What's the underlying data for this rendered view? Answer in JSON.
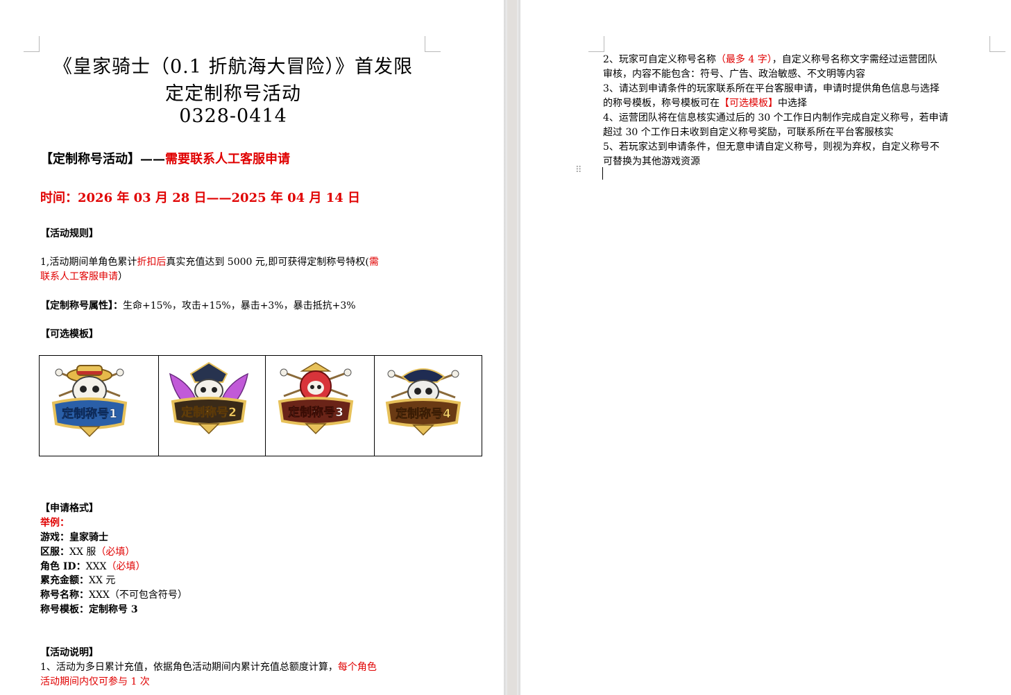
{
  "page1": {
    "title_lines": [
      "《皇家骑士（0.1 折航海大冒险）》首发限",
      "定定制称号活动",
      "0328-0414"
    ],
    "activity_heading": {
      "prefix": "【定制称号活动】——",
      "highlight": "需要联系人工客服申请"
    },
    "time_line": "时间：2026 年 03 月 28 日——2025 年 04 月 14 日",
    "rules_heading": "【活动规则】",
    "rule1": {
      "part1": "1,活动期间单角色累计",
      "part2_red": "折扣后",
      "part3": "真实充值达到 5000 元,即可获得定制称号特权(",
      "part4_red": "需",
      "line2_red": "联系人工客服申请",
      "line2_end": "）"
    },
    "attr": {
      "label": "【定制称号属性】：",
      "value": "生命+15%，攻击+15%，暴击+3%，暴击抵抗+3%"
    },
    "templates_heading": "【可选模板】",
    "templates": [
      {
        "label": "定制称号1",
        "icon": "straw-hat-skull-badge-icon"
      },
      {
        "label": "定制称号2",
        "icon": "winged-pirate-skull-badge-icon"
      },
      {
        "label": "定制称号3",
        "icon": "red-skull-badge-icon"
      },
      {
        "label": "定制称号4",
        "icon": "tricorn-skull-badge-icon"
      }
    ],
    "format": {
      "heading": "【申请格式】",
      "example": "举例：",
      "game": {
        "label": "游戏：",
        "value": "皇家骑士"
      },
      "server": {
        "label": "区服：",
        "value": "XX 服",
        "note": "（必填）"
      },
      "role": {
        "label": "角色 ID：",
        "value": "XXX",
        "note": "（必填）"
      },
      "recharge": {
        "label": "累充金额：",
        "value": "XX 元"
      },
      "name": {
        "label": "称号名称：",
        "value": "XXX（不可包含符号）"
      },
      "template": {
        "label": "称号模板：",
        "value": "定制称号 3"
      }
    },
    "notes": {
      "heading": "【活动说明】",
      "line1_black": "1、活动为多日累计充值，依据角色活动期间内累计充值总额度计算，",
      "line1_red": "每个角色",
      "line2_red": "活动期间内仅可参与 1 次"
    }
  },
  "page2": {
    "item2": {
      "a": "2、玩家可自定义称号名称",
      "b_red": "（最多 4 字）",
      "c": "，自定义称号名称文字需经过运营团队",
      "d": "审核，内容不能包含：符号、广告、政治敏感、不文明等内容"
    },
    "item3": {
      "a": "3、请达到申请条件的玩家联系所在平台客服申请，申请时提供角色信息与选择",
      "b": "的称号模板，称号模板可在",
      "c_red": "【可选模板】",
      "d": "中选择"
    },
    "item4": {
      "a": "4、运营团队将在信息核实通过后的 30 个工作日内制作完成自定义称号，若申请",
      "b": "超过 30 个工作日未收到自定义称号奖励，可联系所在平台客服核实"
    },
    "item5": {
      "a": "5、若玩家达到申请条件，但无意申请自定义称号，则视为弃权，自定义称号不",
      "b": "可替换为其他游戏资源"
    }
  },
  "colors": {
    "accent_red": "#e00000",
    "page_bg": "#ffffff",
    "desk_bg": "#e6e6e6"
  }
}
